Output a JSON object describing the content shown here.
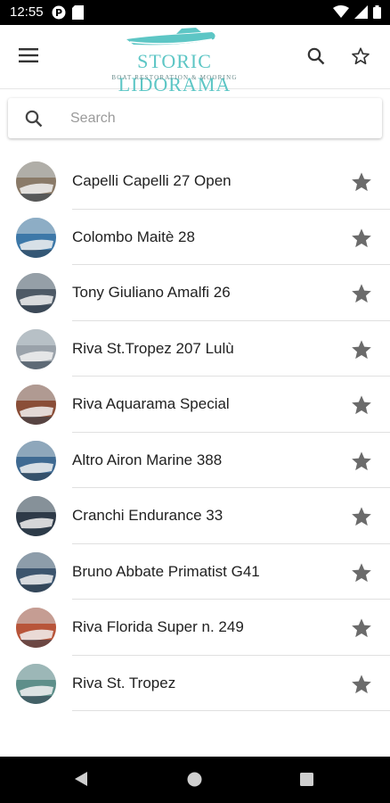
{
  "status_bar": {
    "time": "12:55",
    "left_icons": [
      "app-notification-icon",
      "sd-card-icon"
    ],
    "right_icons": [
      "wifi-icon",
      "cellular-signal-icon",
      "battery-icon"
    ]
  },
  "app_bar": {
    "logo_title": "STORIC LIDORAMA",
    "logo_subtitle": "BOAT RESTORATION & MOORING",
    "brand_color": "#5dc6c5"
  },
  "search": {
    "placeholder": "Search",
    "value": ""
  },
  "boats": [
    {
      "name": "Capelli Capelli 27 Open",
      "avatar_color": "#8a7a68",
      "favorite": true
    },
    {
      "name": "Colombo Maitè 28",
      "avatar_color": "#3d78a8",
      "favorite": true
    },
    {
      "name": "Tony Giuliano Amalfi 26",
      "avatar_color": "#4e5a66",
      "favorite": true
    },
    {
      "name": "Riva St.Tropez 207 Lulù",
      "avatar_color": "#9aa2aa",
      "favorite": true
    },
    {
      "name": "Riva Aquarama Special",
      "avatar_color": "#8a4e38",
      "favorite": true
    },
    {
      "name": "Altro Airon Marine 388",
      "avatar_color": "#3f6a92",
      "favorite": true
    },
    {
      "name": "Cranchi Endurance 33",
      "avatar_color": "#2e3a48",
      "favorite": true
    },
    {
      "name": "Bruno Abbate Primatist G41",
      "avatar_color": "#3c556e",
      "favorite": true
    },
    {
      "name": "Riva Florida Super n. 249",
      "avatar_color": "#b8553a",
      "favorite": true
    },
    {
      "name": "Riva St. Tropez",
      "avatar_color": "#5e8f8a",
      "favorite": true
    }
  ],
  "colors": {
    "star": "#6b6b6b",
    "divider": "#e0e0e0",
    "text": "#212121"
  }
}
